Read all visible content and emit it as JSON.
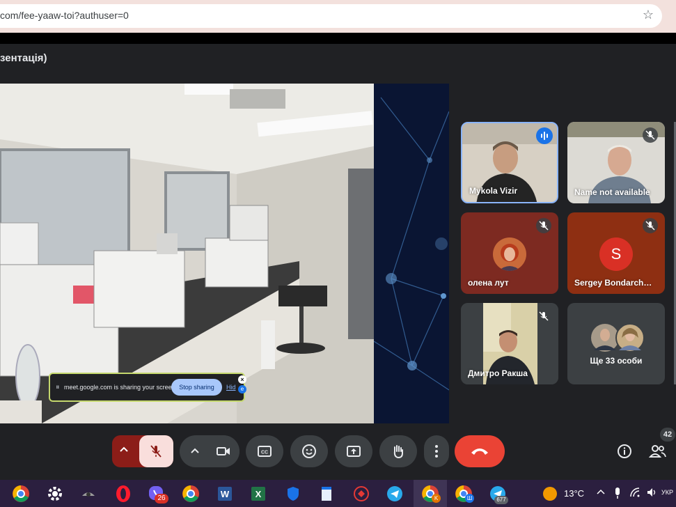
{
  "browser": {
    "url": "com/fee-yaaw-toi?authuser=0",
    "bookmark_icon": "star-icon"
  },
  "meeting": {
    "presentation_title": "зентація)"
  },
  "share_notice": {
    "message": "meet.google.com is sharing your screen.",
    "stop_label": "Stop sharing",
    "hide_label": "Hid"
  },
  "participants": [
    {
      "name": "Mykola Vizir",
      "speaking": true
    },
    {
      "name": "Name not available",
      "muted": true
    },
    {
      "name": "олена лут",
      "muted": true
    },
    {
      "name": "Sergey Bondarch…",
      "initial": "S",
      "muted": true
    },
    {
      "name": "Дмитро Ракша",
      "muted": true
    },
    {
      "name": "Ще 33 особи"
    }
  ],
  "people_count": "42",
  "taskbar": {
    "viber_badge": "26",
    "telegram_badge": "677",
    "chrome_badge_k": "K",
    "chrome_badge_sh": "Ш",
    "temperature": "13°C",
    "lang": "УКР"
  },
  "colors": {
    "accent": "#8ab4f8",
    "end_call": "#ea4335",
    "mic_muted": "#f9dedc"
  }
}
